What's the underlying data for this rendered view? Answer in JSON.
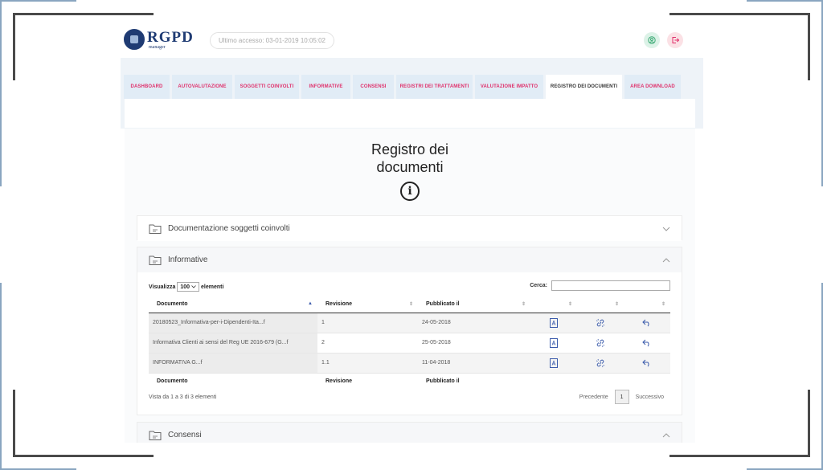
{
  "colors": {
    "brand": "#1f3b73",
    "accent": "#e0306b",
    "nav_bg": "#e1ecf6",
    "action_icon": "#3b5bab"
  },
  "header": {
    "logo_title": "RGPD",
    "logo_subtitle": "manager",
    "last_access": "Ultimo accesso: 03-01-2019 10:05:02",
    "user_icon": "user-circle-icon",
    "logout_icon": "logout-icon"
  },
  "nav": {
    "tabs": [
      {
        "label": "DASHBOARD",
        "active": false
      },
      {
        "label": "AUTOVALUTAZIONE",
        "active": false
      },
      {
        "label": "SOGGETTI COINVOLTI",
        "active": false
      },
      {
        "label": "INFORMATIVE",
        "active": false
      },
      {
        "label": "CONSENSI",
        "active": false
      },
      {
        "label": "REGISTRI DEI TRATTAMENTI",
        "active": false
      },
      {
        "label": "VALUTAZIONE IMPATTO",
        "active": false
      },
      {
        "label": "REGISTRO DEI DOCUMENTI",
        "active": true
      },
      {
        "label": "AREA DOWNLOAD",
        "active": false
      }
    ]
  },
  "main": {
    "title_line1": "Registro dei",
    "title_line2": "documenti",
    "info_glyph": "i",
    "panels": {
      "p1": "Documentazione soggetti coinvolti",
      "p2": "Informative",
      "p3": "Consensi"
    },
    "table": {
      "show_label": "Visualizza",
      "show_value": "100",
      "elements_label": "elementi",
      "search_label": "Cerca:",
      "search_value": "",
      "headers": [
        "Documento",
        "Revisione",
        "Pubblicato il"
      ],
      "rows": [
        {
          "documento": "20180523_Informativa-per-i-Dipendenti-Ita...f",
          "revisione": "1",
          "pubblicato": "24-05-2018"
        },
        {
          "documento": "Informativa Clienti ai sensi del Reg UE 2016-679 (G...f",
          "revisione": "2",
          "pubblicato": "25-05-2018"
        },
        {
          "documento": "INFORMATIVA G...f",
          "revisione": "1.1",
          "pubblicato": "11-04-2018"
        }
      ],
      "footer_info": "Vista da 1 a 3 di 3 elementi",
      "prev_label": "Precedente",
      "page": "1",
      "next_label": "Successivo"
    }
  }
}
